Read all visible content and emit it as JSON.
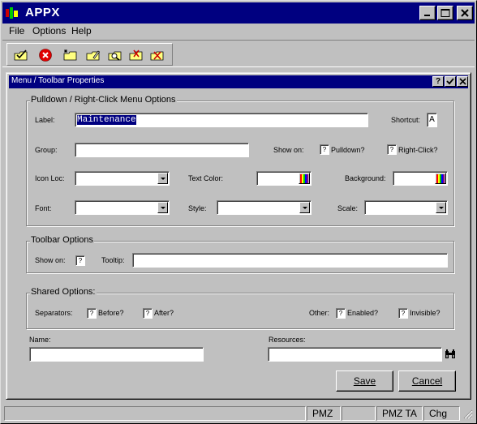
{
  "app": {
    "title": "APPX"
  },
  "menubar": {
    "items": [
      "File",
      "Options",
      "Help"
    ]
  },
  "toolbar": {
    "icons": [
      "check-folder-icon",
      "cancel-icon",
      "new-folder-icon",
      "edit-folder-icon",
      "search-folder-icon",
      "copy-folder-icon",
      "delete-folder-icon"
    ]
  },
  "dialog": {
    "title": "Menu / Toolbar Properties",
    "pulldown_group": {
      "legend": "Pulldown / Right-Click Menu Options",
      "label_label": "Label:",
      "label_value": "Maintenance",
      "shortcut_label": "Shortcut:",
      "shortcut_value": "A",
      "group_label": "Group:",
      "group_value": "",
      "show_on_label": "Show on:",
      "pulldown_label": "Pulldown?",
      "rightclick_label": "Right-Click?",
      "icon_loc_label": "Icon Loc:",
      "text_color_label": "Text Color:",
      "background_label": "Background:",
      "font_label": "Font:",
      "style_label": "Style:",
      "scale_label": "Scale:"
    },
    "toolbar_group": {
      "legend": "Toolbar Options",
      "show_on_label": "Show on:",
      "tooltip_label": "Tooltip:",
      "tooltip_value": ""
    },
    "shared_group": {
      "legend": "Shared Options:",
      "separators_label": "Separators:",
      "before_label": "Before?",
      "after_label": "After?",
      "other_label": "Other:",
      "enabled_label": "Enabled?",
      "invisible_label": "Invisible?"
    },
    "name_label": "Name:",
    "name_value": "",
    "resources_label": "Resources:",
    "resources_value": "",
    "save_label": "Save",
    "cancel_label": "Cancel",
    "checkbox_mark": "?"
  },
  "statusbar": {
    "cells": [
      "",
      "PMZ",
      "",
      "PMZ TA",
      "Chg"
    ]
  },
  "colors": {
    "titlebar": "#000080",
    "face": "#c0c0c0",
    "highlight": "#000080"
  }
}
